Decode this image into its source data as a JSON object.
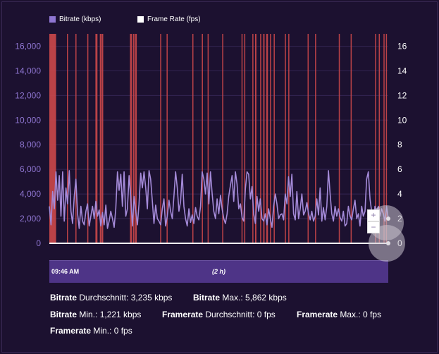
{
  "legend": {
    "bitrate_label": "Bitrate (kbps)",
    "framerate_label": "Frame Rate (fps)",
    "bitrate_color": "#8f76d2",
    "framerate_color": "#ffffff"
  },
  "chart_data": {
    "type": "line",
    "left_axis": {
      "ticks": [
        "0",
        "2,000",
        "4,000",
        "6,000",
        "8,000",
        "10,000",
        "12,000",
        "14,000",
        "16,000"
      ],
      "ylim": [
        0,
        17000
      ]
    },
    "right_axis": {
      "ticks": [
        "0",
        "2",
        "4",
        "6",
        "8",
        "10",
        "12",
        "14",
        "16"
      ],
      "ylim": [
        0,
        17
      ]
    },
    "series": [
      {
        "name": "Bitrate (kbps)",
        "color": "#a48ad8",
        "values": [
          3000,
          1500,
          4200,
          2800,
          5800,
          3500,
          5500,
          2200,
          5800,
          1800,
          4500,
          3200,
          5900,
          2600,
          1600,
          3800,
          5200,
          2400,
          1200,
          3000,
          1800,
          1500,
          2600,
          3200,
          1400,
          2200,
          3000,
          2000,
          3400,
          2200,
          2700,
          1400,
          2500,
          1500,
          3100,
          1200,
          1800,
          2600,
          2000,
          1300,
          2800,
          5800,
          4300,
          5600,
          3000,
          5800,
          2200,
          2800,
          5500,
          3800,
          1400,
          3800,
          2600,
          1500,
          3200,
          5700,
          4500,
          5800,
          4500,
          2800,
          5900,
          5200,
          3400,
          1600,
          3100,
          2000,
          1800,
          1500,
          2800,
          3600,
          1400,
          2200,
          3500,
          2600,
          2000,
          3800,
          5800,
          4500,
          2600,
          3400,
          5600,
          3000,
          2000,
          1400,
          2800,
          1700,
          2300,
          1600,
          2900,
          2200,
          1900,
          3000,
          5800,
          5200,
          4000,
          5700,
          3200,
          5800,
          4000,
          2600,
          2000,
          3600,
          2400,
          3900,
          2800,
          2000,
          1600,
          2400,
          3800,
          4700,
          5500,
          3400,
          5800,
          4800,
          2800,
          3200,
          2100,
          1800,
          4400,
          5800,
          5600,
          3600,
          4600,
          2400,
          1600,
          3800,
          2600,
          3600,
          2000,
          1800,
          2400,
          1500,
          2800,
          2000,
          1300,
          3000,
          4000,
          3200,
          2000,
          2300,
          2400,
          1900,
          4000,
          3200,
          5400,
          3800,
          5600,
          2400,
          1900,
          4200,
          2000,
          2800,
          4000,
          2300,
          2600,
          3300,
          2400,
          1900,
          2600,
          1800,
          2200,
          3600,
          2300,
          4500,
          1800,
          2900,
          1900,
          3000,
          5900,
          4000,
          2400,
          1800,
          3000,
          2200,
          2800,
          2100,
          1800,
          2600,
          1400,
          1600,
          3000,
          2200,
          1900,
          2800,
          3500,
          2000,
          2400,
          1400,
          3000,
          2200,
          2600,
          5200,
          5800,
          3600,
          2600,
          1500,
          3000,
          2600,
          3000,
          2200,
          2800,
          2400,
          1800,
          3000,
          2000
        ]
      },
      {
        "name": "Frame Rate (fps)",
        "color": "#ffffff",
        "values": [
          0
        ]
      }
    ],
    "red_bands": [
      [
        0.0,
        0.02
      ],
      [
        0.052,
        0.055
      ],
      [
        0.077,
        0.08
      ],
      [
        0.112,
        0.115
      ],
      [
        0.136,
        0.142
      ],
      [
        0.149,
        0.154
      ],
      [
        0.155,
        0.159
      ],
      [
        0.238,
        0.244
      ],
      [
        0.247,
        0.251
      ],
      [
        0.253,
        0.258
      ],
      [
        0.327,
        0.33
      ],
      [
        0.346,
        0.348
      ],
      [
        0.422,
        0.425
      ],
      [
        0.45,
        0.452
      ],
      [
        0.467,
        0.47
      ],
      [
        0.51,
        0.513
      ],
      [
        0.567,
        0.569
      ],
      [
        0.575,
        0.578
      ],
      [
        0.599,
        0.602
      ],
      [
        0.607,
        0.611
      ],
      [
        0.622,
        0.624
      ],
      [
        0.631,
        0.635
      ],
      [
        0.64,
        0.645
      ],
      [
        0.651,
        0.654
      ],
      [
        0.662,
        0.665
      ],
      [
        0.695,
        0.698
      ],
      [
        0.705,
        0.708
      ],
      [
        0.762,
        0.764
      ],
      [
        0.784,
        0.787
      ],
      [
        0.854,
        0.857
      ],
      [
        0.889,
        0.892
      ],
      [
        0.961,
        0.964
      ],
      [
        0.972,
        0.975
      ],
      [
        0.986,
        0.989
      ],
      [
        0.993,
        0.996
      ]
    ],
    "band_color": "#c9474a"
  },
  "navigator": {
    "start_label": "09:46 AM",
    "duration_label": "(2 h)"
  },
  "zoom": {
    "in_label": "+",
    "out_label": "−"
  },
  "stats": {
    "bitrate_avg_key": "Bitrate",
    "bitrate_avg_rest": "Durchschnitt: 3,235 kbps",
    "bitrate_max_key": "Bitrate",
    "bitrate_max_rest": "Max.: 5,862 kbps",
    "bitrate_min_key": "Bitrate",
    "bitrate_min_rest": "Min.: 1,221 kbps",
    "framerate_avg_key": "Framerate",
    "framerate_avg_rest": "Durchschnitt: 0 fps",
    "framerate_max_key": "Framerate",
    "framerate_max_rest": "Max.: 0 fps",
    "framerate_min_key": "Framerate",
    "framerate_min_rest": "Min.: 0 fps"
  }
}
